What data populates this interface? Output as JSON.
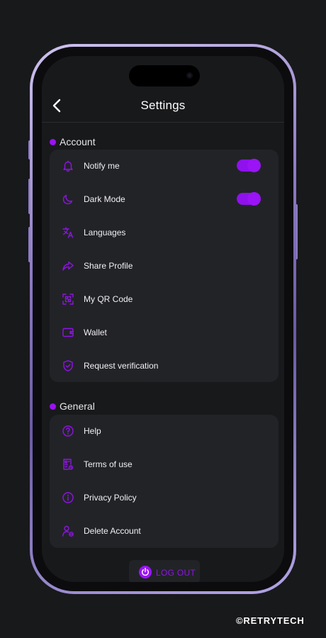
{
  "header": {
    "title": "Settings"
  },
  "account": {
    "label": "Account",
    "items": [
      {
        "label": "Notify me",
        "icon": "bell-icon",
        "toggle": true
      },
      {
        "label": "Dark Mode",
        "icon": "moon-icon",
        "toggle": true
      },
      {
        "label": "Languages",
        "icon": "translate-icon"
      },
      {
        "label": "Share Profile",
        "icon": "share-arrow-icon"
      },
      {
        "label": "My QR Code",
        "icon": "qr-code-icon"
      },
      {
        "label": "Wallet",
        "icon": "wallet-icon"
      },
      {
        "label": "Request verification",
        "icon": "shield-check-icon"
      }
    ]
  },
  "general": {
    "label": "General",
    "items": [
      {
        "label": "Help",
        "icon": "help-icon"
      },
      {
        "label": "Terms of use",
        "icon": "document-icon"
      },
      {
        "label": "Privacy Policy",
        "icon": "info-icon"
      },
      {
        "label": "Delete Account",
        "icon": "user-remove-icon"
      }
    ]
  },
  "logout": {
    "label": "LOG OUT",
    "icon": "power-icon"
  },
  "watermark": "©RETRYTECH",
  "colors": {
    "accent": "#9a14f6",
    "background": "#18191b",
    "card": "#222327"
  }
}
